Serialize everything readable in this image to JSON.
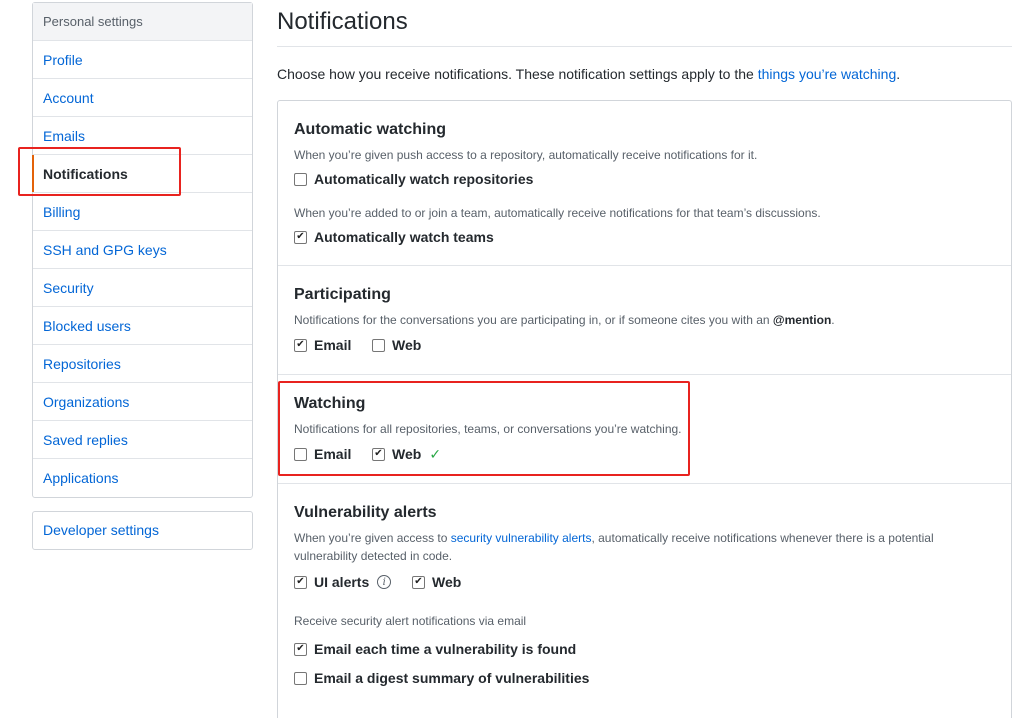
{
  "sidebar": {
    "header": "Personal settings",
    "items": [
      {
        "label": "Profile"
      },
      {
        "label": "Account"
      },
      {
        "label": "Emails"
      },
      {
        "label": "Notifications"
      },
      {
        "label": "Billing"
      },
      {
        "label": "SSH and GPG keys"
      },
      {
        "label": "Security"
      },
      {
        "label": "Blocked users"
      },
      {
        "label": "Repositories"
      },
      {
        "label": "Organizations"
      },
      {
        "label": "Saved replies"
      },
      {
        "label": "Applications"
      }
    ],
    "developer": "Developer settings"
  },
  "main": {
    "title": "Notifications",
    "intro_text": "Choose how you receive notifications. These notification settings apply to the ",
    "intro_link": "things you’re watching",
    "intro_end": ".",
    "sections": {
      "automatic": {
        "title": "Automatic watching",
        "note1": "When you’re given push access to a repository, automatically receive notifications for it.",
        "opt1": {
          "label": "Automatically watch repositories",
          "checked": false
        },
        "note2": "When you’re added to or join a team, automatically receive notifications for that team’s discussions.",
        "opt2": {
          "label": "Automatically watch teams",
          "checked": true
        }
      },
      "participating": {
        "title": "Participating",
        "note_pre": "Notifications for the conversations you are participating in, or if someone cites you with an ",
        "note_mention": "@mention",
        "note_end": ".",
        "email": {
          "label": "Email",
          "checked": true
        },
        "web": {
          "label": "Web",
          "checked": false
        }
      },
      "watching": {
        "title": "Watching",
        "note": "Notifications for all repositories, teams, or conversations you’re watching.",
        "email": {
          "label": "Email",
          "checked": false
        },
        "web": {
          "label": "Web",
          "checked": true
        },
        "saved_mark": "✓"
      },
      "vulnerability": {
        "title": "Vulnerability alerts",
        "note_pre": "When you’re given access to ",
        "note_link": "security vulnerability alerts",
        "note_post": ", automatically receive notifications whenever there is a potential vulnerability detected in code.",
        "ui_alerts": {
          "label": "UI alerts",
          "checked": true
        },
        "info_glyph": "i",
        "web": {
          "label": "Web",
          "checked": true
        },
        "email_note": "Receive security alert notifications via email",
        "email_each": {
          "label": "Email each time a vulnerability is found",
          "checked": true
        },
        "email_digest": {
          "label": "Email a digest summary of vulnerabilities",
          "checked": false
        }
      }
    }
  },
  "colors": {
    "link": "#0366d6",
    "selected_accent": "#e36209",
    "highlight_box": "#e8231f",
    "success": "#28a745"
  }
}
